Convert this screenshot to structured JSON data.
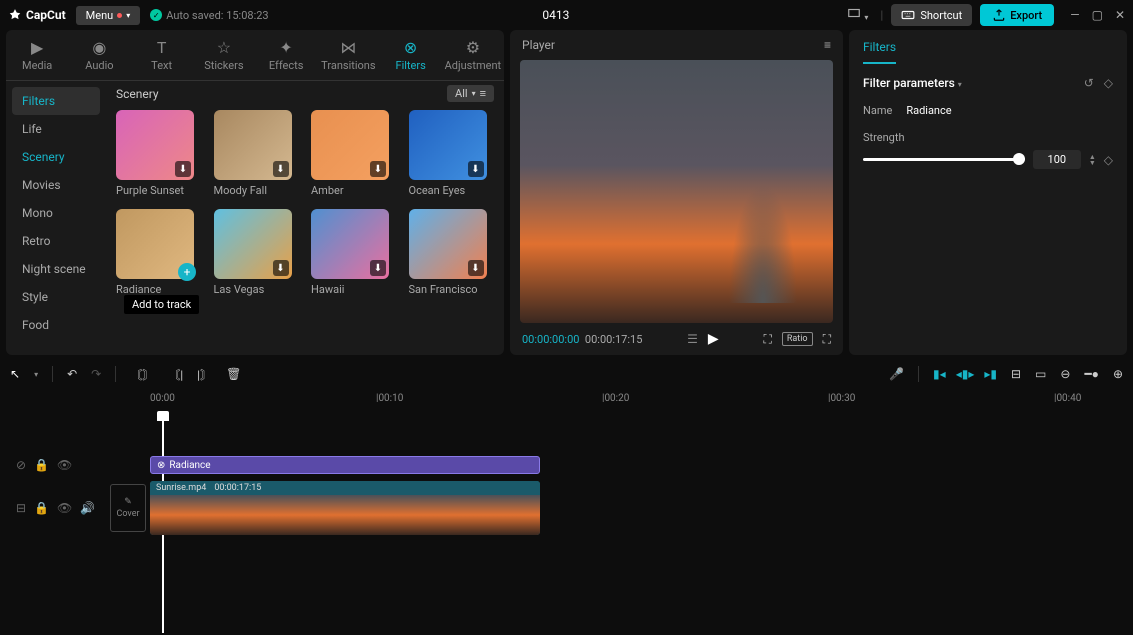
{
  "titlebar": {
    "app_name": "CapCut",
    "menu_label": "Menu",
    "autosave": "Auto saved: 15:08:23",
    "project_title": "0413",
    "shortcut_label": "Shortcut",
    "export_label": "Export"
  },
  "tabs": [
    "Media",
    "Audio",
    "Text",
    "Stickers",
    "Effects",
    "Transitions",
    "Filters",
    "Adjustment"
  ],
  "active_tab": "Filters",
  "side_nav": {
    "selected": "Filters",
    "active": "Scenery",
    "items": [
      "Filters",
      "Life",
      "Scenery",
      "Movies",
      "Mono",
      "Retro",
      "Night scene",
      "Style",
      "Food"
    ]
  },
  "grid": {
    "section_title": "Scenery",
    "all_label": "All",
    "tooltip": "Add to track",
    "items": [
      {
        "label": "Purple Sunset"
      },
      {
        "label": "Moody Fall"
      },
      {
        "label": "Amber"
      },
      {
        "label": "Ocean Eyes"
      },
      {
        "label": "Radiance"
      },
      {
        "label": "Las Vegas"
      },
      {
        "label": "Hawaii"
      },
      {
        "label": "San Francisco"
      }
    ]
  },
  "player": {
    "title": "Player",
    "current_time": "00:00:00:00",
    "total_time": "00:00:17:15",
    "ratio_label": "Ratio"
  },
  "inspector": {
    "panel_title": "Filters",
    "section_title": "Filter parameters",
    "name_label": "Name",
    "name_value": "Radiance",
    "strength_label": "Strength",
    "strength_value": "100"
  },
  "timeline": {
    "ruler": [
      "00:00",
      "|00:10",
      "|00:20",
      "|00:30",
      "|00:40"
    ],
    "filter_clip": "Radiance",
    "video_clip": {
      "name": "Sunrise.mp4",
      "duration": "00:00:17:15"
    },
    "cover_label": "Cover"
  }
}
